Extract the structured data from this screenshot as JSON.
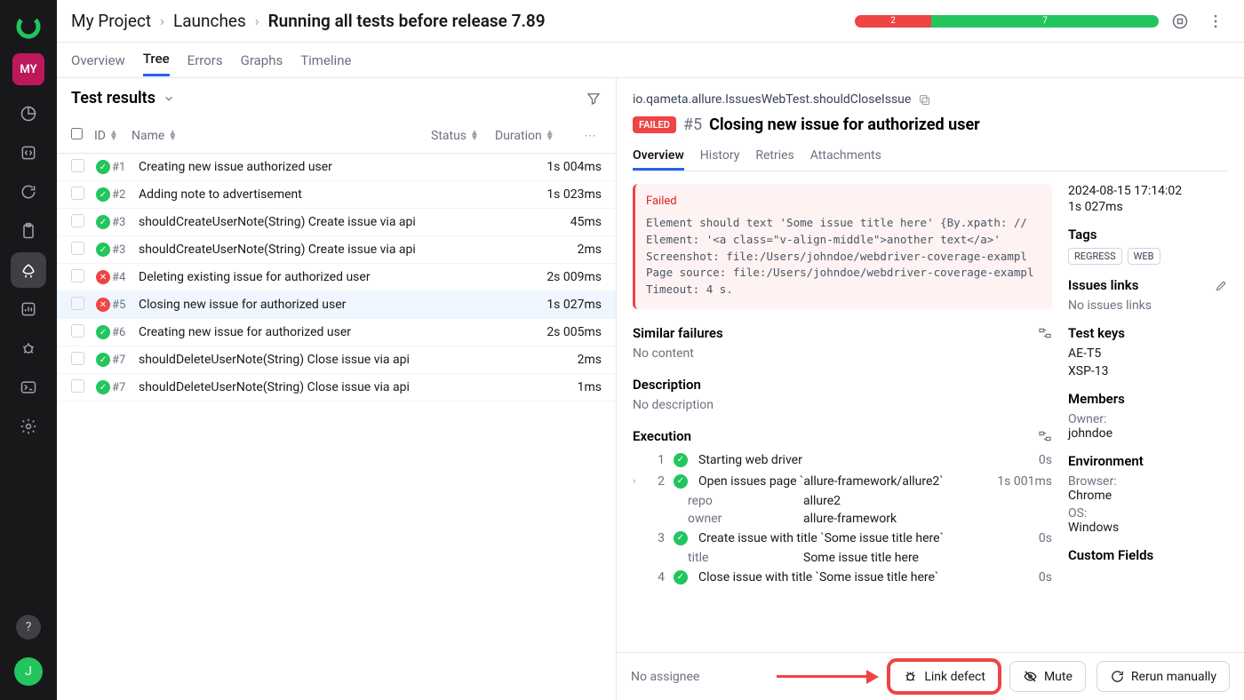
{
  "breadcrumb": {
    "project": "My Project",
    "section": "Launches",
    "current": "Running all tests before release 7.89"
  },
  "statusbar": {
    "failed": "2",
    "passed": "7"
  },
  "headerAvatar": "MY",
  "mainTabs": {
    "overview": "Overview",
    "tree": "Tree",
    "errors": "Errors",
    "graphs": "Graphs",
    "timeline": "Timeline"
  },
  "leftPane": {
    "title": "Test results",
    "cols": {
      "id": "ID",
      "name": "Name",
      "status": "Status",
      "duration": "Duration"
    },
    "rows": [
      {
        "status": "pass",
        "id": "#1",
        "name": "Creating new issue authorized user",
        "dur": "1s 004ms"
      },
      {
        "status": "pass",
        "id": "#2",
        "name": "Adding note to advertisement",
        "dur": "1s 023ms"
      },
      {
        "status": "pass",
        "id": "#3",
        "name": "shouldCreateUserNote(String) Create issue via api",
        "dur": "45ms"
      },
      {
        "status": "pass",
        "id": "#3",
        "name": "shouldCreateUserNote(String) Create issue via api",
        "dur": "2ms"
      },
      {
        "status": "fail",
        "id": "#4",
        "name": "Deleting existing issue for authorized user",
        "dur": "2s 009ms"
      },
      {
        "status": "fail",
        "id": "#5",
        "name": "Closing new issue for authorized user",
        "dur": "1s 027ms",
        "selected": true
      },
      {
        "status": "pass",
        "id": "#6",
        "name": "Creating new issue for authorized user",
        "dur": "2s 005ms"
      },
      {
        "status": "pass",
        "id": "#7",
        "name": "shouldDeleteUserNote(String) Close issue via api",
        "dur": "2ms"
      },
      {
        "status": "pass",
        "id": "#7",
        "name": "shouldDeleteUserNote(String) Close issue via api",
        "dur": "1ms"
      }
    ]
  },
  "detail": {
    "path": "io.qameta.allure.IssuesWebTest.shouldCloseIssue",
    "badge": "FAILED",
    "num": "#5",
    "title": "Closing new issue for authorized user",
    "tabs": {
      "overview": "Overview",
      "history": "History",
      "retries": "Retries",
      "attachments": "Attachments"
    },
    "error": {
      "head": "Failed",
      "body": "Element should text 'Some issue title here' {By.xpath: //\nElement: '<a class=\"v-align-middle\">another text</a>'\nScreenshot: file:/Users/johndoe/webdriver-coverage-exampl\nPage source: file:/Users/johndoe/webdriver-coverage-exampl\nTimeout: 4 s."
    },
    "similar": {
      "head": "Similar failures",
      "body": "No content"
    },
    "description": {
      "head": "Description",
      "body": "No description"
    },
    "execution": {
      "head": "Execution",
      "steps": [
        {
          "n": "1",
          "txt": "Starting web driver",
          "dur": "0s"
        },
        {
          "n": "2",
          "txt": "Open issues page `allure-framework/allure2`",
          "dur": "1s 001ms",
          "expand": true,
          "params": [
            {
              "k": "repo",
              "v": "allure2"
            },
            {
              "k": "owner",
              "v": "allure-framework"
            }
          ]
        },
        {
          "n": "3",
          "txt": "Create issue with title `Some issue title here`",
          "dur": "0s",
          "params": [
            {
              "k": "title",
              "v": "Some issue title here"
            }
          ]
        },
        {
          "n": "4",
          "txt": "Close issue with title `Some issue title here`",
          "dur": "0s"
        }
      ]
    },
    "meta": {
      "time": "2024-08-15 17:14:02",
      "dur": "1s 027ms",
      "tagsHead": "Tags",
      "tags": [
        "REGRESS",
        "WEB"
      ],
      "issuesHead": "Issues links",
      "issuesEmpty": "No issues links",
      "keysHead": "Test keys",
      "keys": [
        "AE-T5",
        "XSP-13"
      ],
      "membersHead": "Members",
      "ownerLbl": "Owner:",
      "owner": "johndoe",
      "envHead": "Environment",
      "browserLbl": "Browser:",
      "browser": "Chrome",
      "osLbl": "OS:",
      "os": "Windows",
      "customHead": "Custom Fields"
    }
  },
  "footer": {
    "assignee": "No assignee",
    "linkDefect": "Link defect",
    "mute": "Mute",
    "rerun": "Rerun manually"
  },
  "userInitial": "J"
}
